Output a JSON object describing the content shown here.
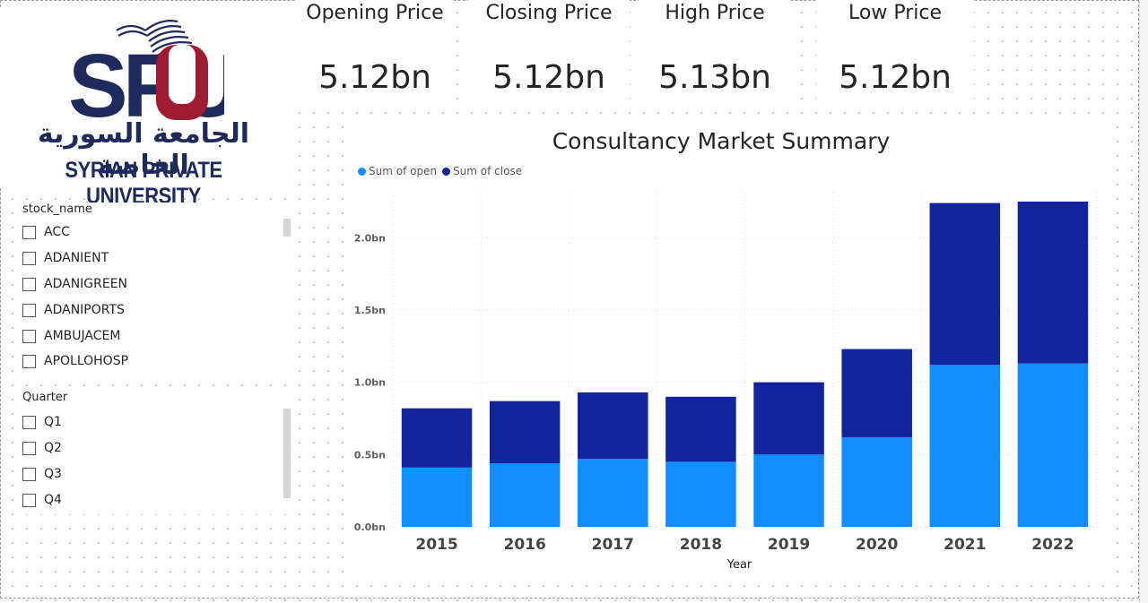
{
  "logo": {
    "letters": "SPU",
    "arabic_name": "الجامعة السورية الخاصة",
    "english_name": "SYRIAN PRIVATE UNIVERSITY",
    "navy": "#1f2a5c",
    "red": "#9e1b32"
  },
  "kpis": [
    {
      "label": "Opening Price",
      "value": "5.12bn"
    },
    {
      "label": "Closing Price",
      "value": "5.12bn"
    },
    {
      "label": "High Price",
      "value": "5.13bn"
    },
    {
      "label": "Low Price",
      "value": "5.12bn"
    }
  ],
  "slicers": {
    "stock": {
      "title": "stock_name",
      "items": [
        "ACC",
        "ADANIENT",
        "ADANIGREEN",
        "ADANIPORTS",
        "AMBUJACEM",
        "APOLLOHOSP"
      ]
    },
    "quarter": {
      "title": "Quarter",
      "items": [
        "Q1",
        "Q2",
        "Q3",
        "Q4"
      ]
    }
  },
  "chart_data": {
    "type": "bar",
    "stacked": true,
    "title": "Consultancy Market Summary",
    "xlabel": "Year",
    "ylabel": "",
    "categories": [
      "2015",
      "2016",
      "2017",
      "2018",
      "2019",
      "2020",
      "2021",
      "2022"
    ],
    "series": [
      {
        "name": "Sum of open",
        "color": "#118dff",
        "values": [
          0.41,
          0.44,
          0.47,
          0.45,
          0.5,
          0.62,
          1.12,
          1.13
        ]
      },
      {
        "name": "Sum of close",
        "color": "#12239e",
        "values": [
          0.41,
          0.43,
          0.46,
          0.45,
          0.5,
          0.61,
          1.12,
          1.12
        ]
      }
    ],
    "ylim": [
      0,
      2.25
    ],
    "yticks": [
      0,
      0.5,
      1.0,
      1.5,
      2.0
    ],
    "ytick_labels": [
      "0.0bn",
      "0.5bn",
      "1.0bn",
      "1.5bn",
      "2.0bn"
    ],
    "grid": true,
    "legend_position": "top-left"
  }
}
